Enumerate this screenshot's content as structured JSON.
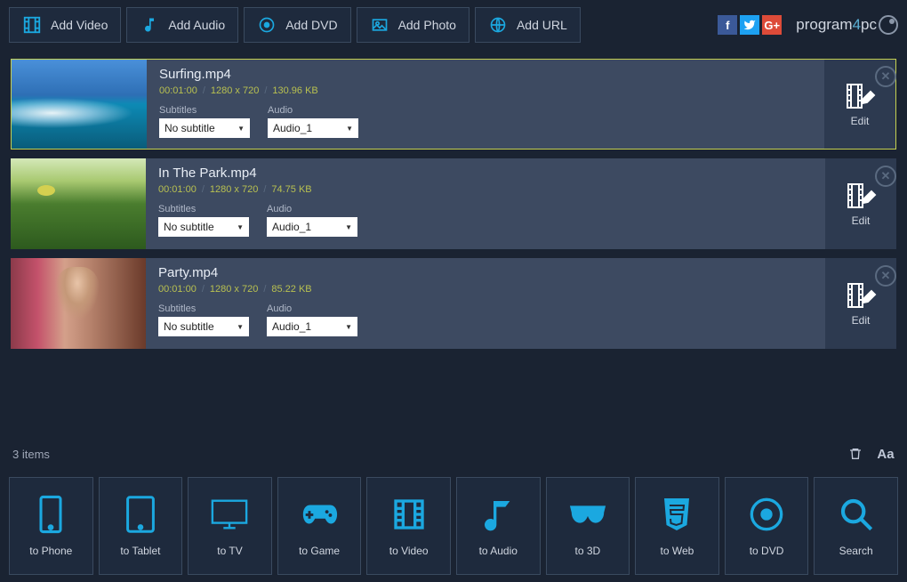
{
  "toolbar": {
    "add_video": "Add Video",
    "add_audio": "Add Audio",
    "add_dvd": "Add DVD",
    "add_photo": "Add Photo",
    "add_url": "Add URL"
  },
  "brand": {
    "p1": "program",
    "num": "4",
    "p2": "pc"
  },
  "media": [
    {
      "title": "Surfing.mp4",
      "duration": "00:01:00",
      "resolution": "1280 x 720",
      "size": "130.96 KB",
      "subtitle_label": "Subtitles",
      "subtitle_value": "No subtitle",
      "audio_label": "Audio",
      "audio_value": "Audio_1",
      "edit": "Edit",
      "selected": true,
      "thumb": "surf"
    },
    {
      "title": "In The Park.mp4",
      "duration": "00:01:00",
      "resolution": "1280 x 720",
      "size": "74.75 KB",
      "subtitle_label": "Subtitles",
      "subtitle_value": "No subtitle",
      "audio_label": "Audio",
      "audio_value": "Audio_1",
      "edit": "Edit",
      "selected": false,
      "thumb": "park"
    },
    {
      "title": "Party.mp4",
      "duration": "00:01:00",
      "resolution": "1280 x 720",
      "size": "85.22 KB",
      "subtitle_label": "Subtitles",
      "subtitle_value": "No subtitle",
      "audio_label": "Audio",
      "audio_value": "Audio_1",
      "edit": "Edit",
      "selected": false,
      "thumb": "party"
    }
  ],
  "status": {
    "count": "3  items"
  },
  "output": {
    "phone": "to Phone",
    "tablet": "to Tablet",
    "tv": "to TV",
    "game": "to Game",
    "video": "to Video",
    "audio": "to Audio",
    "threed": "to 3D",
    "web": "to Web",
    "dvd": "to DVD",
    "search": "Search"
  }
}
